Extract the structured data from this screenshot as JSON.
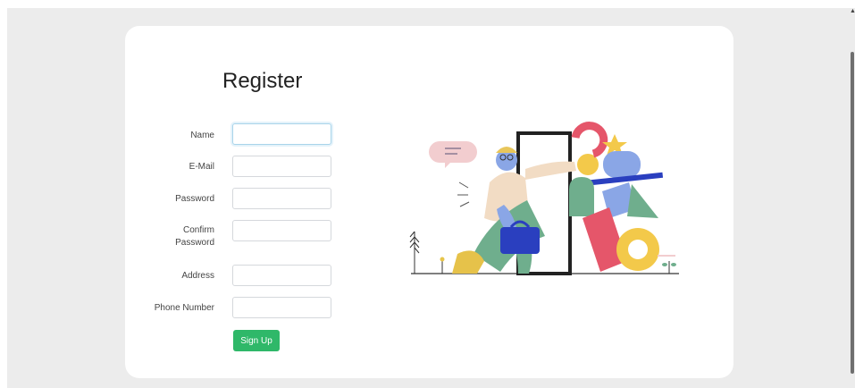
{
  "page": {
    "title": "Register"
  },
  "form": {
    "fields": [
      {
        "label": "Name",
        "value": "",
        "placeholder": ""
      },
      {
        "label": "E-Mail",
        "value": "",
        "placeholder": ""
      },
      {
        "label": "Password",
        "value": "",
        "placeholder": ""
      },
      {
        "label_line1": "Confirm",
        "label_line2": "Password",
        "value": "",
        "placeholder": ""
      },
      {
        "label": "Address",
        "value": "",
        "placeholder": ""
      },
      {
        "label": "Phone Number",
        "value": "",
        "placeholder": ""
      }
    ],
    "focused_field": "Name",
    "submit_label": "Sign Up"
  },
  "illustration": {
    "icon": "person-stepping-through-door-with-shapes-illustration"
  },
  "colors": {
    "background": "#ececec",
    "card": "#ffffff",
    "button": "#2fb869",
    "focus_border": "#a8d4ea"
  }
}
